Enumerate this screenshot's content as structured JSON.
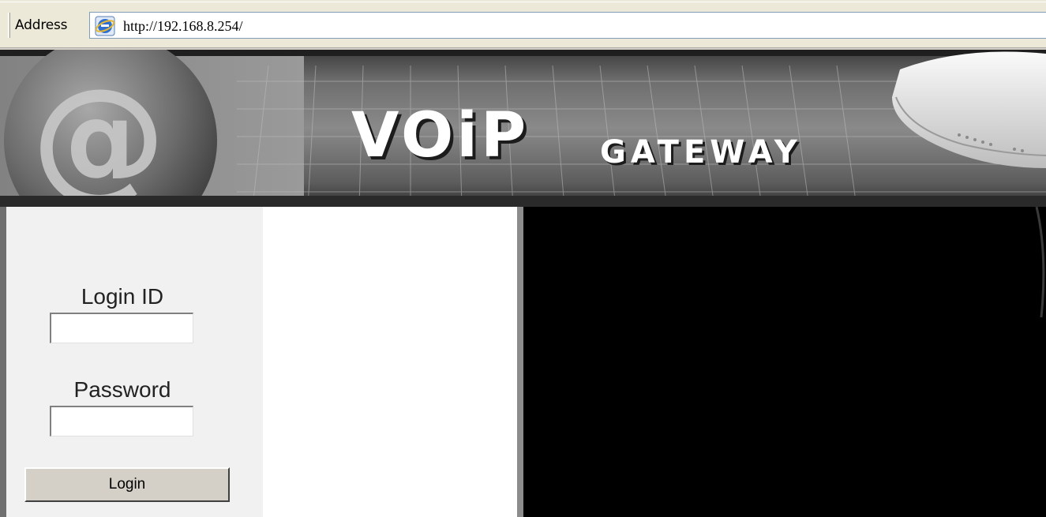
{
  "browser": {
    "address_label": "Address",
    "url": "http://192.168.8.254/",
    "icon": "ie-page-icon"
  },
  "banner": {
    "title": "VOiP",
    "subtitle": "GATEWAY"
  },
  "login": {
    "id_label": "Login ID",
    "id_value": "",
    "password_label": "Password",
    "password_value": "",
    "button_label": "Login"
  },
  "colors": {
    "sidebar_bg": "#f1f1f1",
    "main_bg": "#000000",
    "button_bg": "#d4d0c8"
  }
}
